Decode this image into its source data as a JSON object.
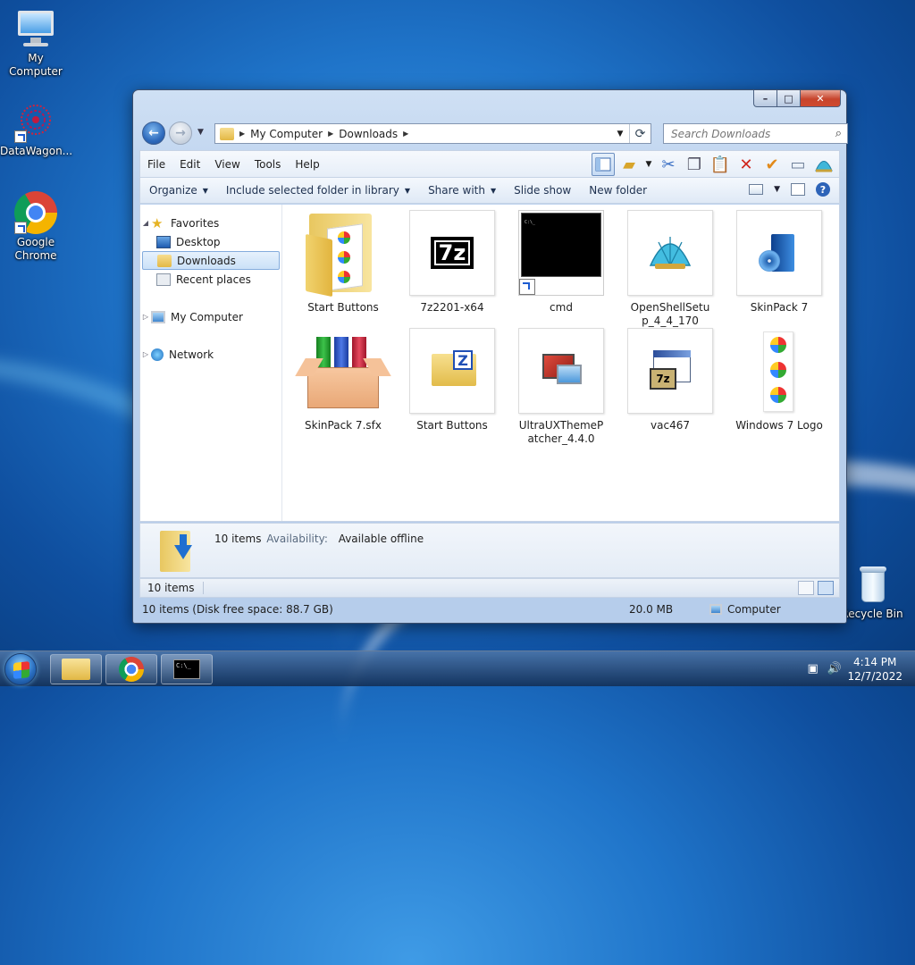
{
  "desktop": {
    "icons": [
      {
        "label": "My Computer"
      },
      {
        "label": "DataWagon..."
      },
      {
        "label": "Google Chrome"
      },
      {
        "label": "Recycle Bin"
      }
    ]
  },
  "window": {
    "controls": {
      "min": "–",
      "max": "□",
      "close": "✕"
    },
    "address": {
      "crumbs": [
        "My Computer",
        "Downloads"
      ]
    },
    "search": {
      "placeholder": "Search Downloads"
    },
    "menu": [
      "File",
      "Edit",
      "View",
      "Tools",
      "Help"
    ],
    "commands": {
      "organize": "Organize",
      "include": "Include selected folder in library",
      "share": "Share with",
      "slideshow": "Slide show",
      "newfolder": "New folder"
    },
    "nav": {
      "favorites": "Favorites",
      "desktop": "Desktop",
      "downloads": "Downloads",
      "recent": "Recent places",
      "computer": "My Computer",
      "network": "Network"
    },
    "files": [
      {
        "name": "Start Buttons"
      },
      {
        "name": "7z2201-x64"
      },
      {
        "name": "cmd"
      },
      {
        "name": "OpenShellSetup_4_4_170"
      },
      {
        "name": "SkinPack 7"
      },
      {
        "name": "SkinPack 7.sfx"
      },
      {
        "name": "Start Buttons"
      },
      {
        "name": "UltraUXThemePatcher_4.4.0"
      },
      {
        "name": "vac467"
      },
      {
        "name": "Windows 7 Logo"
      }
    ],
    "details": {
      "count": "10 items",
      "availability_label": "Availability:",
      "availability_value": "Available offline"
    },
    "status": {
      "items": "10 items",
      "summary": "10 items (Disk free space: 88.7 GB)",
      "size": "20.0 MB",
      "location": "Computer"
    }
  },
  "taskbar": {
    "time": "4:14 PM",
    "date": "12/7/2022"
  }
}
